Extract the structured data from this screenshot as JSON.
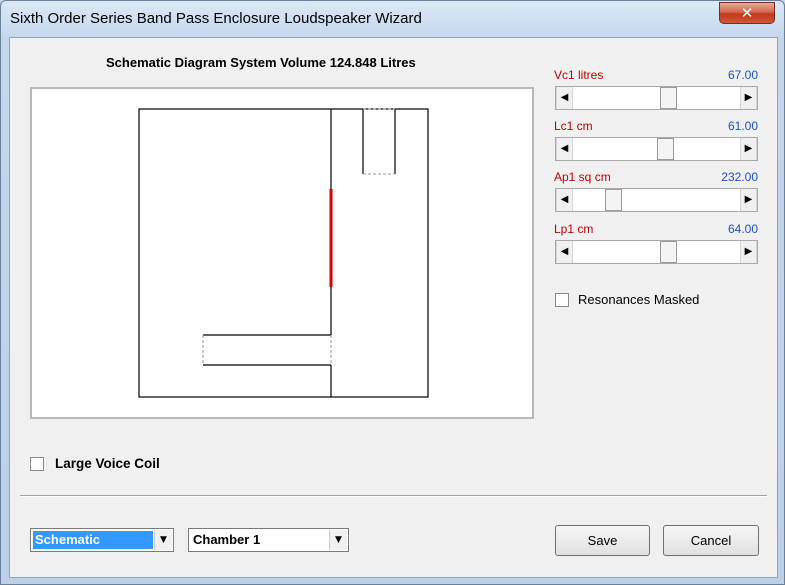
{
  "window": {
    "title": "Sixth Order Series Band Pass Enclosure Loudspeaker Wizard",
    "close_glyph": "✕"
  },
  "schematic": {
    "heading": "Schematic Diagram   System Volume 124.848 Litres"
  },
  "params": [
    {
      "label": "Vc1  litres",
      "value": "67.00",
      "level": 0.58
    },
    {
      "label": "Lc1  cm",
      "value": "61.00",
      "level": 0.56
    },
    {
      "label": "Ap1  sq cm",
      "value": "232.00",
      "level": 0.21
    },
    {
      "label": "Lp1  cm",
      "value": "64.00",
      "level": 0.58
    }
  ],
  "scroll_arrows": {
    "left": "◀",
    "right": "▶"
  },
  "resonances": {
    "label": "Resonances Masked",
    "checked": false
  },
  "voice_coil": {
    "label": "Large Voice Coil",
    "checked": false
  },
  "view_combo": {
    "value": "Schematic",
    "arrow": "▼"
  },
  "chamber_combo": {
    "value": "Chamber 1",
    "arrow": "▼"
  },
  "buttons": {
    "save": "Save",
    "cancel": "Cancel"
  },
  "colors": {
    "driver": "#e00000",
    "param_label": "#c00000",
    "param_value": "#1f4fcc"
  }
}
